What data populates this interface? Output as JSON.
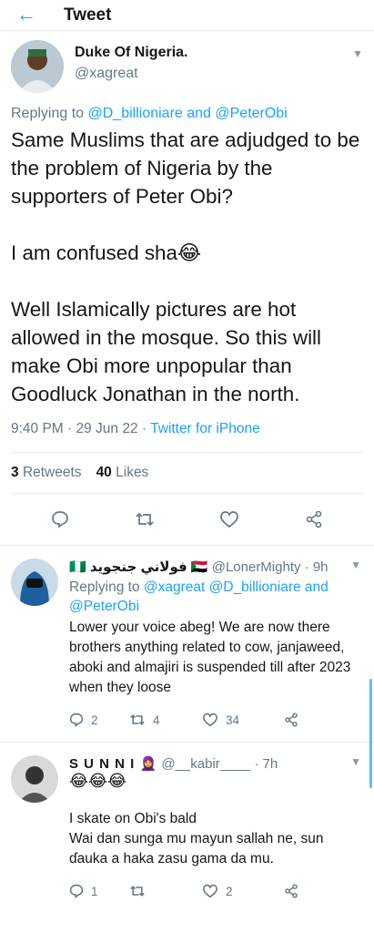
{
  "header": {
    "back_label": "←",
    "title": "Tweet"
  },
  "main_tweet": {
    "display_name": "Duke Of Nigeria.",
    "handle": "@xagreat",
    "replying_prefix": "Replying to",
    "replying_to": "@D_billioniare and @PeterObi",
    "text": "Same Muslims that are adjudged to be the problem of Nigeria by the supporters of Peter Obi?\n\nI am confused sha😂\n\nWell Islamically pictures are hot allowed in the mosque. So this will make Obi more unpopular than Goodluck Jonathan in the north.",
    "time": "9:40 PM · 29 Jun 22 · ",
    "source": "Twitter for iPhone",
    "retweets_count": "3",
    "retweets_label": "Retweets",
    "likes_count": "40",
    "likes_label": "Likes"
  },
  "replies": [
    {
      "display_name": "🇳🇬 فولاني جنجويد 🇸🇩",
      "handle": "@LonerMighty",
      "age": " · 9h",
      "replying_prefix": "Replying to",
      "replying_to": "@xagreat @D_billioniare and @PeterObi",
      "text": "Lower your voice abeg! We are now there brothers anything related to cow, janjaweed, aboki and almajiri is suspended till after 2023 when they loose",
      "reply_count": "2",
      "retweet_count": "4",
      "like_count": "34"
    },
    {
      "display_name": "S U N N I 🧕",
      "handle": "@__kabir____",
      "age": " · 7h",
      "emojis": "😂😂😂",
      "text": "I skate on Obi's bald\nWai dan sunga mu mayun sallah ne, sun ɗauka a haka zasu gama da mu.",
      "reply_count": "1",
      "retweet_count": "",
      "like_count": "2"
    }
  ],
  "colors": {
    "accent": "#1da1f2",
    "secondary": "#657786"
  }
}
